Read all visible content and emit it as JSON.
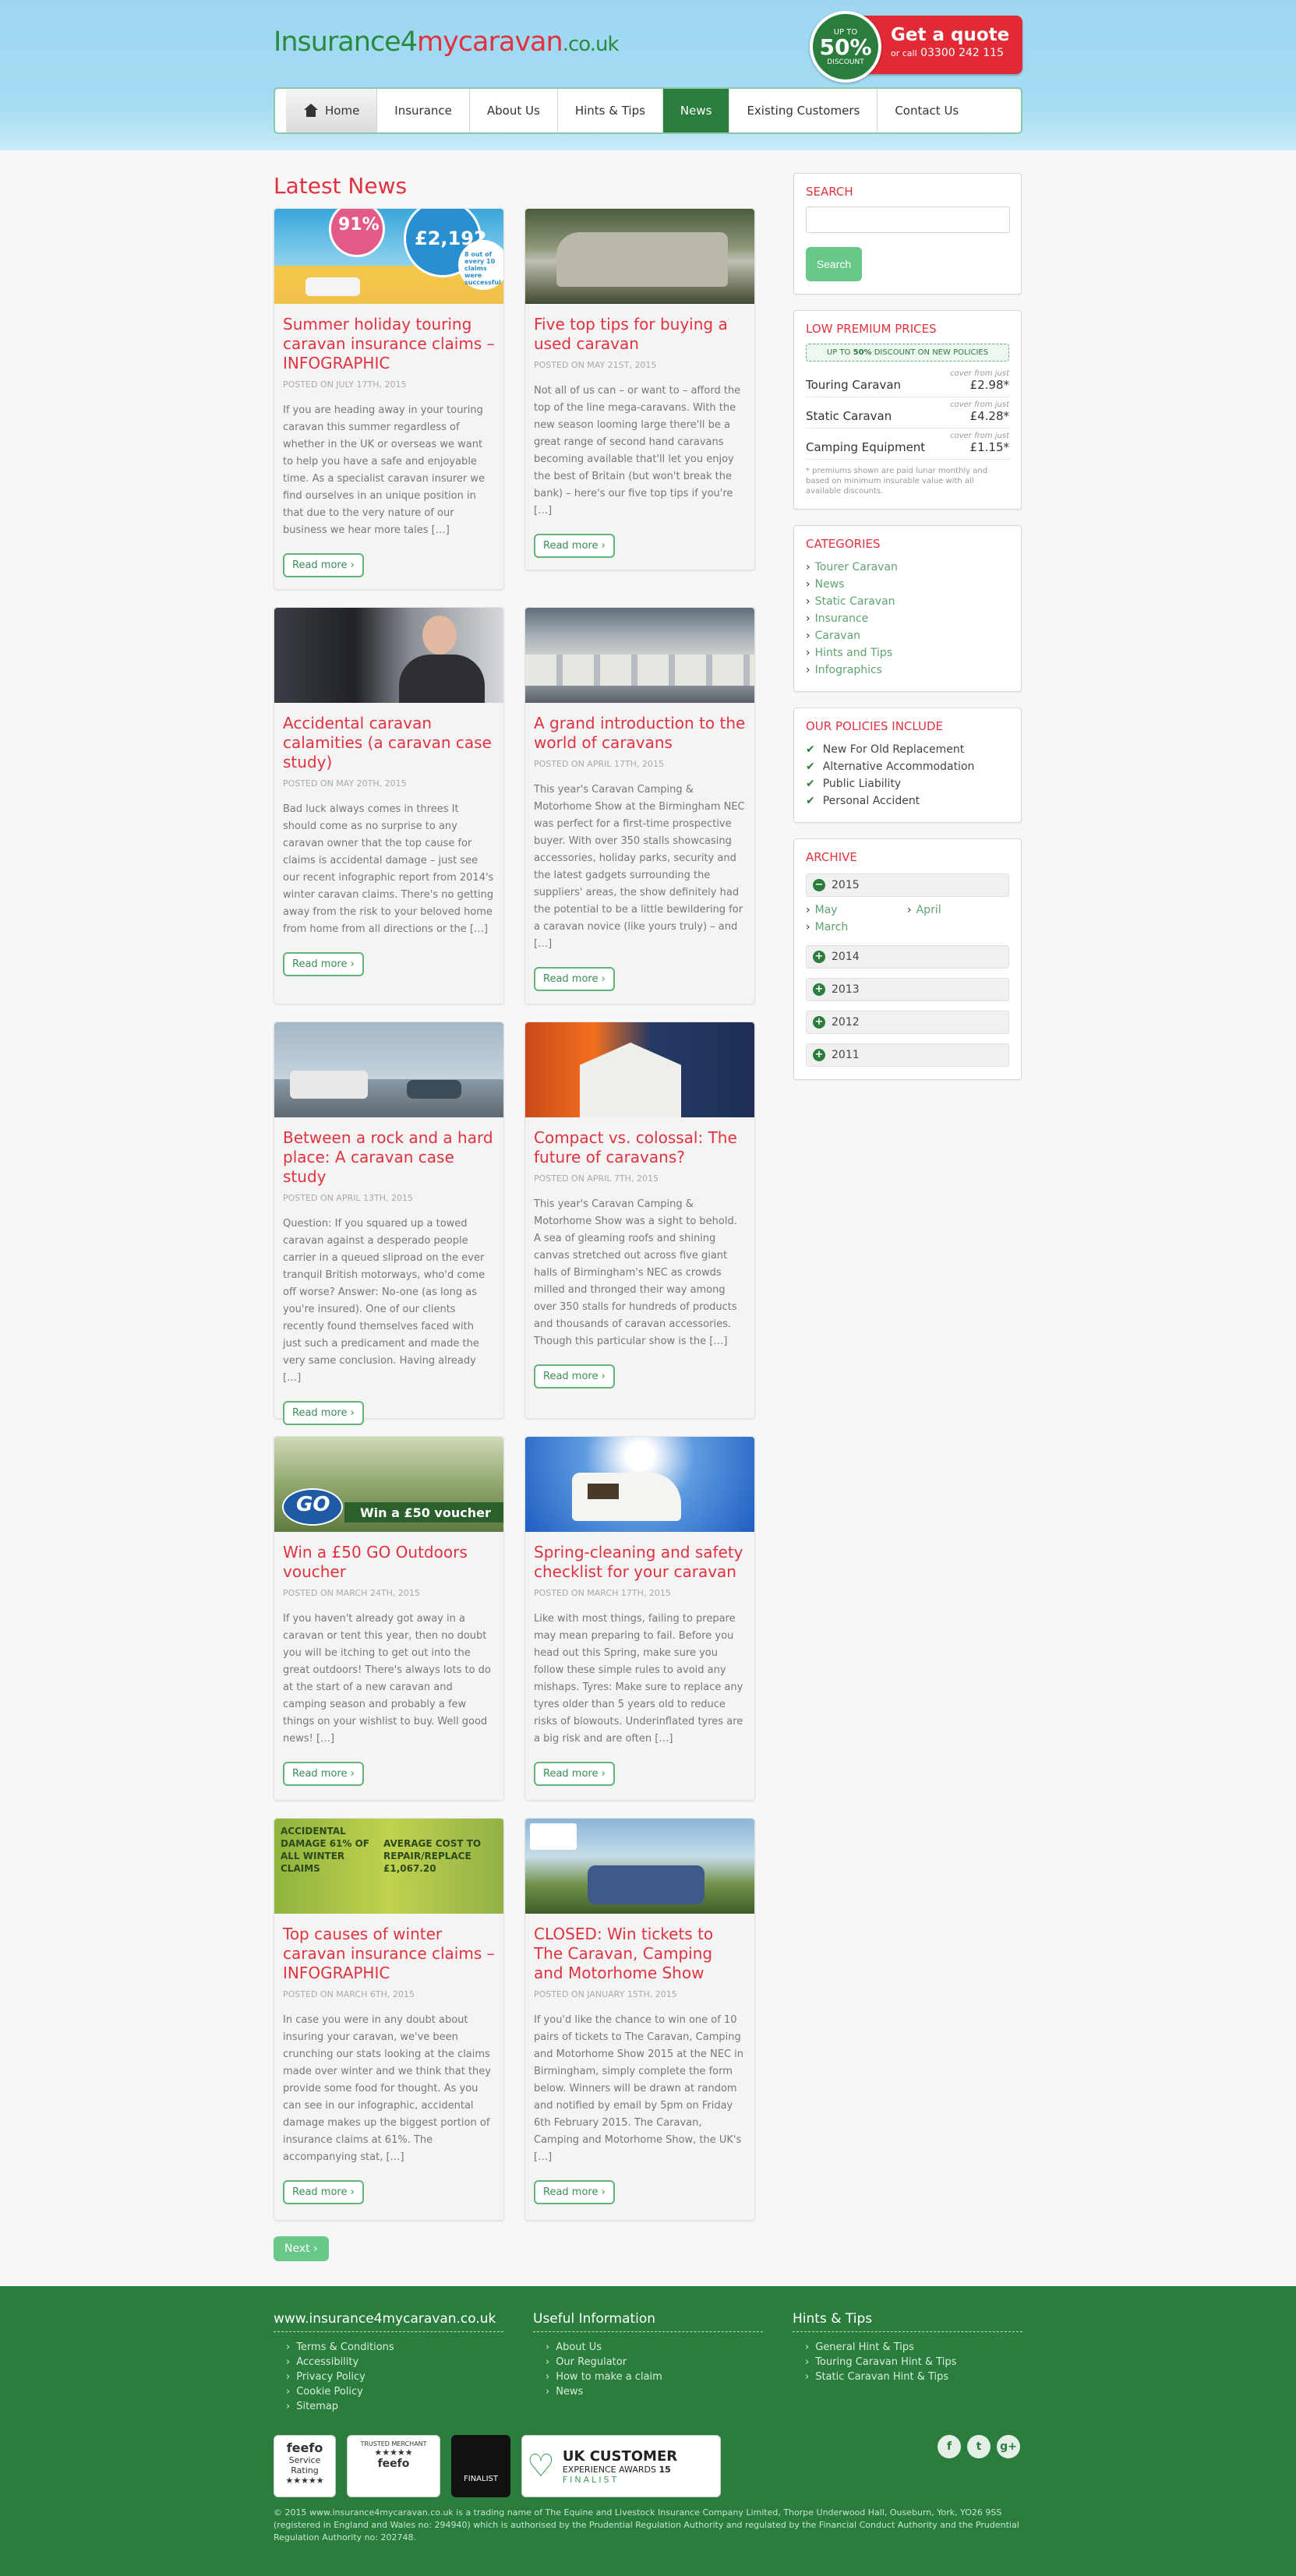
{
  "header": {
    "logo": {
      "part1": "Insurance4",
      "part2": "mycaravan",
      "part3": ".co.uk"
    },
    "quote_badge": {
      "top": "UP TO",
      "pct": "50%",
      "bottom": "DISCOUNT"
    },
    "quote_box": {
      "title": "Get a quote",
      "or_call": "or call",
      "phone": "03300 242 115"
    },
    "nav": [
      "Home",
      "Insurance",
      "About Us",
      "Hints & Tips",
      "News",
      "Existing Customers",
      "Contact Us"
    ]
  },
  "main": {
    "title": "Latest News",
    "posts": [
      {
        "title": "Summer holiday touring caravan insurance claims – INFOGRAPHIC",
        "date": "POSTED ON JULY 17TH, 2015",
        "excerpt": "If you are heading away in your touring caravan this summer regardless of whether in the UK or overseas we want to help you have a safe and enjoyable time. As a specialist caravan insurer we find ourselves in an unique position in that due to the very nature of our business we hear more tales […]",
        "read_more": "Read more"
      },
      {
        "title": "Five top tips for buying a used caravan",
        "date": "POSTED ON MAY 21ST, 2015",
        "excerpt": "Not all of us can – or want to – afford the top of the line mega-caravans. With the new season looming large there'll be a great range of second hand caravans becoming available that'll let you enjoy the best of Britain (but won't break the bank) – here's our five top tips if you're […]",
        "read_more": "Read more"
      },
      {
        "title": "Accidental caravan calamities (a caravan case study)",
        "date": "POSTED ON MAY 20TH, 2015",
        "excerpt": "Bad luck always comes in threes It should come as no surprise to any caravan owner that the top cause for claims is accidental damage – just see our recent infographic report from 2014's winter caravan claims. There's no getting away from the risk to your beloved home from home from all directions or the […]",
        "read_more": "Read more"
      },
      {
        "title": "A grand introduction to the world of caravans",
        "date": "POSTED ON APRIL 17TH, 2015",
        "excerpt": "This year's Caravan Camping & Motorhome Show at the Birmingham NEC was perfect for a first-time prospective buyer. With over 350 stalls showcasing accessories, holiday parks, security and the latest gadgets surrounding the suppliers' areas, the show definitely had the potential to be a little bewildering for a caravan novice (like yours truly) – and […]",
        "read_more": "Read more"
      },
      {
        "title": "Between a rock and a hard place: A caravan case study",
        "date": "POSTED ON APRIL 13TH, 2015",
        "excerpt": "Question: If you squared up a towed caravan against a desperado people carrier in a queued sliproad on the ever tranquil British motorways, who'd come off worse? Answer: No-one (as long as you're insured). One of our clients recently found themselves faced with just such a predicament and made the very same conclusion. Having already […]",
        "read_more": "Read more"
      },
      {
        "title": "Compact vs. colossal: The future of caravans?",
        "date": "POSTED ON APRIL 7TH, 2015",
        "excerpt": "This year's Caravan Camping & Motorhome Show was a sight to behold. A sea of gleaming roofs and shining canvas stretched out across five giant halls of Birmingham's NEC as crowds milled and thronged their way among over 350 stalls for hundreds of products and thousands of caravan accessories. Though this particular show is the […]",
        "read_more": "Read more"
      },
      {
        "title": "Win a £50 GO Outdoors voucher",
        "date": "POSTED ON MARCH 24TH, 2015",
        "excerpt": "If you haven't already got away in a caravan or tent this year, then no doubt you will be itching to get out into the great outdoors! There's always lots to do at the start of a new caravan and camping season and probably a few things on your wishlist to buy. Well good news! […]",
        "read_more": "Read more"
      },
      {
        "title": "Spring-cleaning and safety checklist for your caravan",
        "date": "POSTED ON MARCH 17TH, 2015",
        "excerpt": "Like with most things, failing to prepare may mean preparing to fail. Before you head out this Spring, make sure you follow these simple rules to avoid any mishaps. Tyres: Make sure to replace any tyres older than 5 years old to reduce risks of blowouts. Underinflated tyres are a big risk and are often […]",
        "read_more": "Read more"
      },
      {
        "title": "Top causes of winter caravan insurance claims – INFOGRAPHIC",
        "date": "POSTED ON MARCH 6TH, 2015",
        "excerpt": "In case you were in any doubt about insuring your caravan, we've been crunching our stats looking at the claims made over winter and we think that they provide some food for thought. As you can see in our infographic, accidental damage makes up the biggest portion of insurance claims at 61%. The accompanying stat, […]",
        "read_more": "Read more"
      },
      {
        "title": "CLOSED: Win tickets to The Caravan, Camping and Motorhome Show",
        "date": "POSTED ON JANUARY 15TH, 2015",
        "excerpt": "If you'd like the chance to win one of 10 pairs of tickets to The Caravan, Camping and Motorhome Show 2015 at the NEC in Birmingham, simply complete the form below. Winners will be drawn at random and notified by email by 5pm on Friday 6th February 2015. The Caravan, Camping and Motorhome Show, the UK's […]",
        "read_more": "Read more"
      }
    ],
    "thumb_text": {
      "t1_pct": "91%",
      "t1_amount": "£2,192",
      "t1_small": "8 out of every 10 claims were successful",
      "t7_banner": "Win a £50 voucher",
      "t7_logo": "GO",
      "t9_left": "ACCIDENTAL DAMAGE 61% OF ALL WINTER CLAIMS",
      "t9_right": "AVERAGE COST TO REPAIR/REPLACE £1,067.20"
    },
    "next": "Next"
  },
  "sidebar": {
    "search": {
      "title": "SEARCH",
      "button": "Search"
    },
    "prices": {
      "title": "LOW PREMIUM PRICES",
      "discount_pre": "UP TO",
      "discount_pct": "50%",
      "discount_post": "DISCOUNT ON NEW POLICIES",
      "items": [
        {
          "label": "Touring Caravan",
          "cover": "cover from just",
          "price": "£2.98*"
        },
        {
          "label": "Static Caravan",
          "cover": "cover from just",
          "price": "£4.28*"
        },
        {
          "label": "Camping Equipment",
          "cover": "cover from just",
          "price": "£1.15*"
        }
      ],
      "note": "* premiums shown are paid lunar monthly and based on minimum insurable value with all available discounts."
    },
    "categories": {
      "title": "CATEGORIES",
      "items": [
        "Tourer Caravan",
        "News",
        "Static Caravan",
        "Insurance",
        "Caravan",
        "Hints and Tips",
        "Infographics"
      ]
    },
    "policies": {
      "title": "OUR POLICIES INCLUDE",
      "items": [
        "New For Old Replacement",
        "Alternative Accommodation",
        "Public Liability",
        "Personal Accident"
      ]
    },
    "archive": {
      "title": "ARCHIVE",
      "y2015": "2015",
      "months": [
        "May",
        "April",
        "March"
      ],
      "years": [
        "2014",
        "2013",
        "2012",
        "2011"
      ]
    }
  },
  "footer": {
    "col1": {
      "title": "www.insurance4mycaravan.co.uk",
      "links": [
        "Terms & Conditions",
        "Accessibility",
        "Privacy Policy",
        "Cookie Policy",
        "Sitemap"
      ]
    },
    "col2": {
      "title": "Useful Information",
      "links": [
        "About Us",
        "Our Regulator",
        "How to make a claim",
        "News"
      ]
    },
    "col3": {
      "title": "Hints & Tips",
      "links": [
        "General Hint & Tips",
        "Touring Caravan Hint & Tips",
        "Static Caravan Hint & Tips"
      ]
    },
    "awards": {
      "feefo": "feefo",
      "service": "Service Rating",
      "trusted": "TRUSTED MERCHANT",
      "finalist": "FINALIST",
      "uk_title": "UK CUSTOMER",
      "uk_sub": "EXPERIENCE AWARDS",
      "uk_year": "15",
      "uk_final": "FINALIST"
    },
    "social": [
      "f",
      "t",
      "g+"
    ],
    "copyright": "© 2015 www.insurance4mycaravan.co.uk is a trading name of The Equine and Livestock Insurance Company Limited, Thorpe Underwood Hall, Ouseburn, York, YO26 9SS (registered in England and Wales no: 294940) which is authorised by the Prudential Regulation Authority and regulated by the Financial Conduct Authority and the Prudential Regulation Authority no: 202748."
  },
  "colors": {
    "brand_green": "#2a7d3c",
    "brand_red": "#e2323f",
    "sky": "#a3dcf3"
  }
}
